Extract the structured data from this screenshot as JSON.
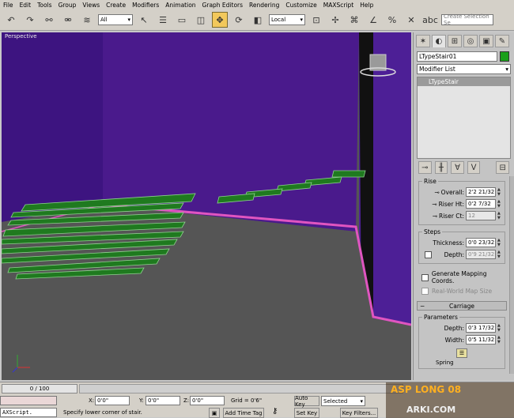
{
  "menu": [
    "File",
    "Edit",
    "Tools",
    "Group",
    "Views",
    "Create",
    "Modifiers",
    "Animation",
    "Graph Editors",
    "Rendering",
    "Customize",
    "MAXScript",
    "Help"
  ],
  "toolbar": {
    "selection_filter": "All",
    "coord_system": "Local",
    "named_selection_placeholder": "Create Selection Se"
  },
  "viewport": {
    "label": "Perspective",
    "colors": {
      "wall": "#4a1a8c",
      "floor": "#5a5a5a",
      "stair": "#1f7a1f",
      "edge": "#e055c0"
    }
  },
  "command_panel": {
    "tabs": [
      "create-icon",
      "modify-icon",
      "hierarchy-icon",
      "motion-icon",
      "display-icon",
      "utilities-icon"
    ],
    "object_name": "LTypeStair01",
    "object_color": "#1aa01a",
    "modifier_list": "Modifier List",
    "stack_item": "LTypeStair",
    "rise": {
      "title": "Rise",
      "overall_label": "Overall:",
      "overall_value": "2'2 21/32",
      "riser_ht_label": "Riser Ht:",
      "riser_ht_value": "0'2 7/32",
      "riser_ct_label": "Riser Ct:",
      "riser_ct_value": "12"
    },
    "steps": {
      "title": "Steps",
      "thickness_label": "Thickness:",
      "thickness_value": "0'0 23/32",
      "depth_label": "Depth:",
      "depth_value": "0'9 21/32"
    },
    "generate_mapping": "Generate Mapping Coords.",
    "real_world": "Real-World Map Size",
    "carriage": {
      "title": "Carriage",
      "params_title": "Parameters",
      "depth_label": "Depth:",
      "depth_value": "0'3 17/32",
      "width_label": "Width:",
      "width_value": "0'5 11/32",
      "spring_label": "Spring"
    }
  },
  "status": {
    "time_slider": "0 / 100",
    "x_value": "0'0\"",
    "y_value": "0'0\"",
    "z_value": "0'0\"",
    "grid": "Grid = 0'6\"",
    "auto_key": "Auto Key",
    "selected": "Selected",
    "set_key": "Set Key",
    "key_filters": "Key Filters...",
    "add_time_tag": "Add Time Tag",
    "maxscript": "AXScript.",
    "prompt": "Specify lower corner of stair."
  },
  "watermark": {
    "text": "ASP LONG 08",
    "text2": "ARKI.COM"
  }
}
